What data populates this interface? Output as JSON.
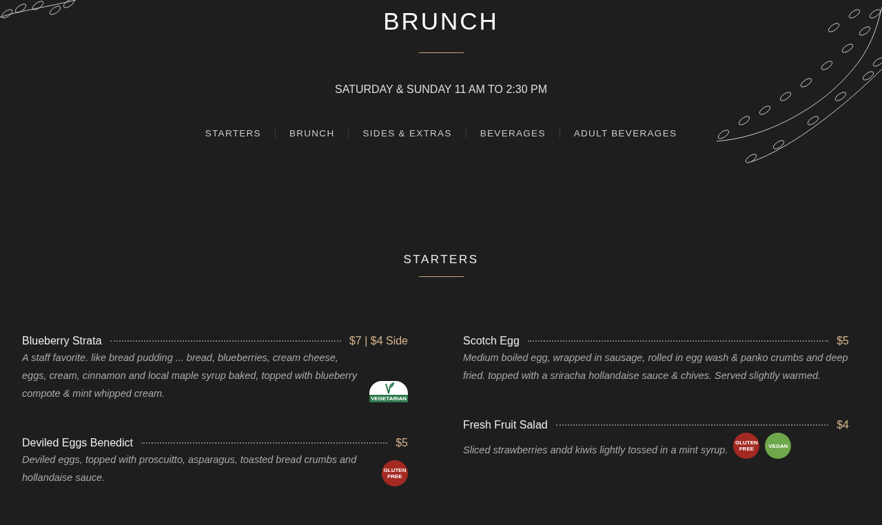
{
  "header": {
    "title": "BRUNCH",
    "hours": "SATURDAY & SUNDAY 11 AM TO 2:30 PM"
  },
  "nav": [
    {
      "label": "STARTERS"
    },
    {
      "label": "BRUNCH"
    },
    {
      "label": "SIDES & EXTRAS"
    },
    {
      "label": "BEVERAGES"
    },
    {
      "label": "ADULT BEVERAGES"
    }
  ],
  "section": {
    "title": "STARTERS",
    "columns": [
      [
        {
          "name": "Blueberry Strata",
          "price": "$7 | $4 Side",
          "description": "A staff favorite. like bread pudding ... bread, blueberries, cream cheese, eggs, cream, cinnamon and local maple syrup baked, topped with blueberry compote & mint whipped cream.",
          "badges": [
            {
              "kind": "vegetarian",
              "label": "VEGETARIAN"
            }
          ]
        },
        {
          "name": "Deviled Eggs Benedict",
          "price": "$5",
          "description": "Deviled eggs, topped with proscuitto, asparagus, toasted bread crumbs and hollandaise sauce.",
          "badges": [
            {
              "kind": "gluten_free",
              "label": "GLUTEN FREE"
            }
          ]
        }
      ],
      [
        {
          "name": "Scotch Egg",
          "price": "$5",
          "description": "Medium boiled egg, wrapped in sausage, rolled in egg wash & panko crumbs and deep fried. topped with a sriracha hollandaise sauce & chives. Served slightly warmed."
        },
        {
          "name": "Fresh Fruit Salad",
          "price": "$4",
          "description": "Sliced strawberries andd kiwis lightly tossed in a mint syrup.",
          "badges": [
            {
              "kind": "gluten_free",
              "label": "GLUTEN FREE"
            },
            {
              "kind": "vegan",
              "label": "VEGAN"
            }
          ]
        }
      ]
    ]
  }
}
